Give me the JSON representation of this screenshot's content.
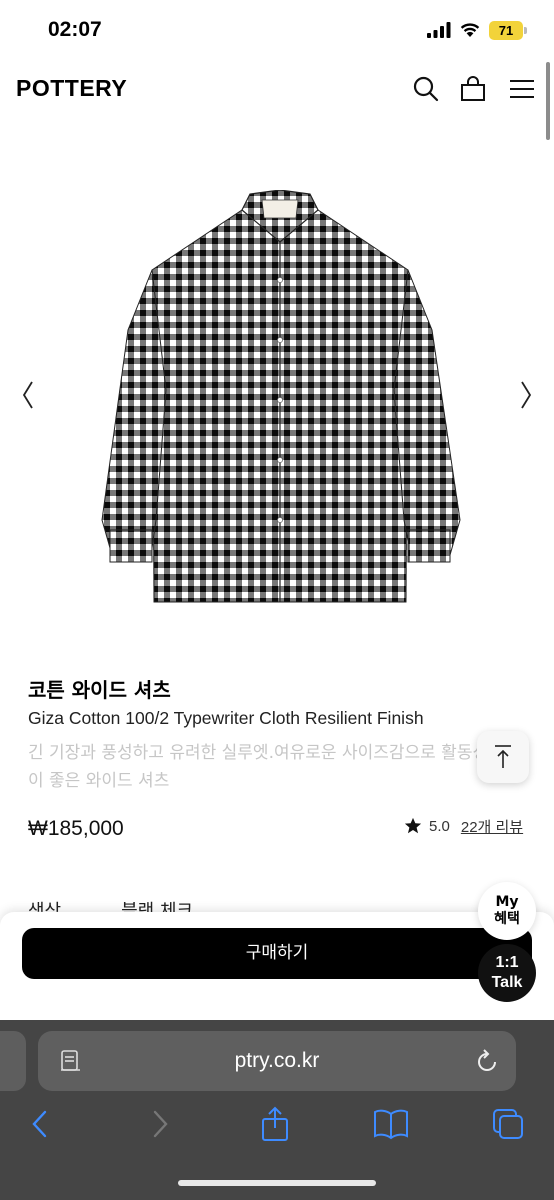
{
  "status_bar": {
    "time": "02:07",
    "battery": "71"
  },
  "header": {
    "logo": "POTTERY",
    "icons": [
      "search-icon",
      "shopping-bag-icon",
      "menu-icon"
    ]
  },
  "gallery": {
    "image": "black and white gingham check shirt",
    "prev_icon": "chevron-left-icon",
    "next_icon": "chevron-right-icon"
  },
  "product": {
    "name_ko": "코튼 와이드 셔츠",
    "name_en": "Giza Cotton 100/2 Typewriter Cloth Resilient Finish",
    "description": "긴 기장과 풍성하고 유려한 실루엣.여유로운 사이즈감으로 활동성이 좋은 와이드 셔츠",
    "price": "₩185,000",
    "rating": "5.0",
    "review_count": "22개 리뷰"
  },
  "option": {
    "label": "색상",
    "value": "블랙 체크"
  },
  "buy_button": "구매하기",
  "floating": {
    "my_benefit_line1": "My",
    "my_benefit_line2": "혜택",
    "talk_line1": "1:1",
    "talk_line2": "Talk"
  },
  "browser": {
    "url": "ptry.co.kr"
  },
  "colors": {
    "accent": "#000000",
    "battery": "#f2d33a",
    "toolbar": "#454545",
    "toolbar_icon": "#3e8bff"
  }
}
